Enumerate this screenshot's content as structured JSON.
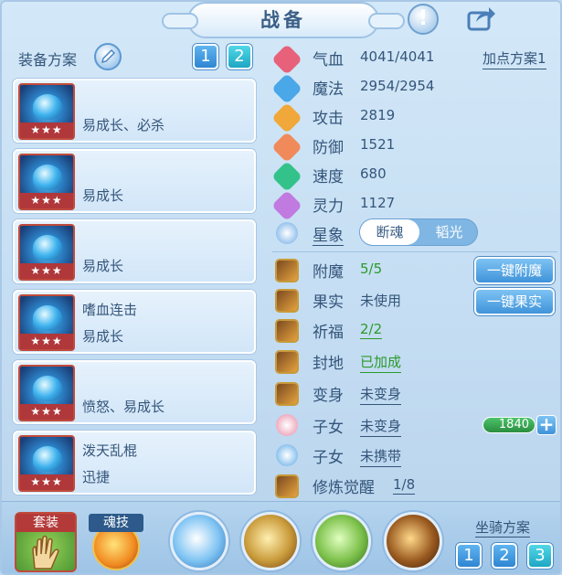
{
  "title": "战备",
  "left": {
    "plan_label": "装备方案",
    "plan_tabs": [
      "1",
      "2"
    ],
    "active_plan": "2",
    "equipment": [
      {
        "stars": "★★★",
        "line1": "",
        "line2": "易成长、必杀"
      },
      {
        "stars": "★★★",
        "line1": "",
        "line2": "易成长"
      },
      {
        "stars": "★★★",
        "line1": "",
        "line2": "易成长"
      },
      {
        "stars": "★★★",
        "line1": "嗜血连击",
        "line2": "易成长"
      },
      {
        "stars": "★★★",
        "line1": "",
        "line2": "愤怒、易成长"
      },
      {
        "stars": "★★★",
        "line1": "泼天乱棍",
        "line2": "迅捷"
      }
    ]
  },
  "stats": {
    "add_point_plan": "加点方案1",
    "items": [
      {
        "label": "气血",
        "value": "4041/4041",
        "icon": "heart-icon",
        "color": "#e8617a"
      },
      {
        "label": "魔法",
        "value": "2954/2954",
        "icon": "mana-icon",
        "color": "#4aa7e8"
      },
      {
        "label": "攻击",
        "value": "2819",
        "icon": "sword-icon",
        "color": "#f0a83a"
      },
      {
        "label": "防御",
        "value": "1521",
        "icon": "shield-icon",
        "color": "#f08a5a"
      },
      {
        "label": "速度",
        "value": "680",
        "icon": "lightning-icon",
        "color": "#33c38a"
      },
      {
        "label": "灵力",
        "value": "1127",
        "icon": "spirit-icon",
        "color": "#c07ae0"
      }
    ],
    "star_label": "星象",
    "star_options": [
      "断魂",
      "韬光"
    ]
  },
  "features": [
    {
      "label": "附魔",
      "value": "5/5",
      "icon": "enchant-icon",
      "style": "green"
    },
    {
      "label": "果实",
      "value": "未使用",
      "icon": "fruit-icon",
      "style": "plain"
    },
    {
      "label": "祈福",
      "value": "2/2",
      "icon": "blessing-icon",
      "style": "green-u"
    },
    {
      "label": "封地",
      "value": "已加成",
      "icon": "fief-icon",
      "style": "green-u"
    },
    {
      "label": "变身",
      "value": "未变身",
      "icon": "transform-icon",
      "style": "u"
    },
    {
      "label": "子女",
      "value": "未变身",
      "icon": "child-girl-icon",
      "style": "u"
    },
    {
      "label": "子女",
      "value": "未携带",
      "icon": "child-paw-icon",
      "style": "u"
    },
    {
      "label": "修炼觉醒",
      "value": "1/8",
      "icon": "cultivation-icon",
      "style": "u"
    }
  ],
  "buttons": {
    "one_key_enchant": "一键附魔",
    "one_key_fruit": "一键果实"
  },
  "child_bar_value": "1840",
  "bottom": {
    "set_label": "套装",
    "soul_skill_label": "魂技",
    "mount_plan_label": "坐骑方案",
    "mount_tabs": [
      "1",
      "2",
      "3"
    ],
    "active_mount": "3"
  }
}
